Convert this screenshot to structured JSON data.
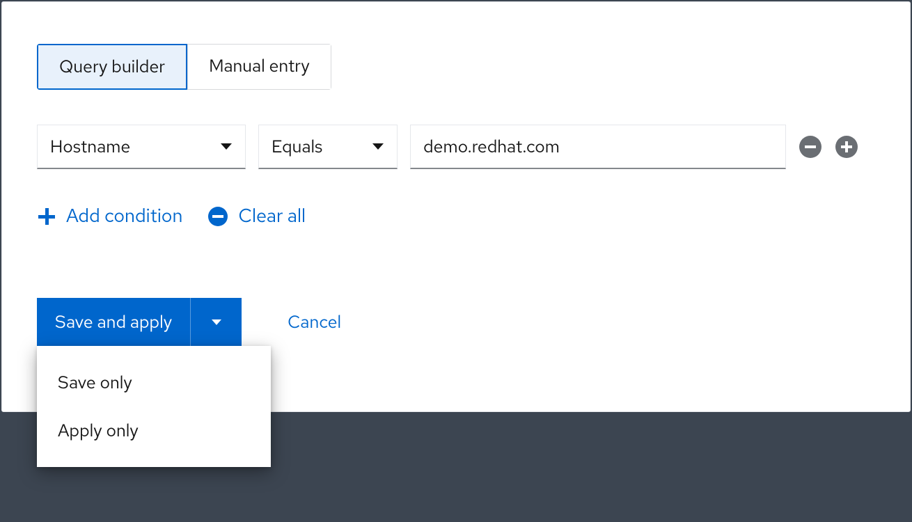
{
  "tabs": {
    "query_builder": "Query builder",
    "manual_entry": "Manual entry"
  },
  "condition": {
    "field": "Hostname",
    "operator": "Equals",
    "value": "demo.redhat.com"
  },
  "actions": {
    "add_condition": "Add condition",
    "clear_all": "Clear all"
  },
  "footer": {
    "save_and_apply": "Save and apply",
    "cancel": "Cancel",
    "menu": {
      "save_only": "Save only",
      "apply_only": "Apply only"
    }
  },
  "colors": {
    "primary": "#0066cc",
    "icon_muted": "#6a6e73"
  }
}
